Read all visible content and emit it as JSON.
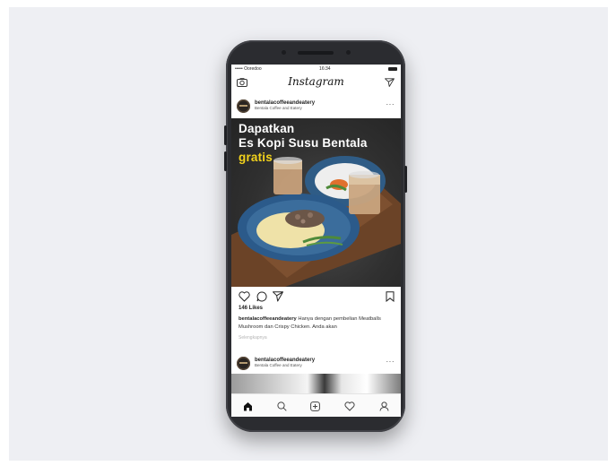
{
  "status_bar": {
    "carrier": "••••• Ooredoo",
    "time": "16:34"
  },
  "app_bar": {
    "title": "Instagram"
  },
  "post": {
    "username": "bentalacoffeeandeatery",
    "location": "Bentala Coffee and Eatery",
    "image_text": {
      "line1": "Dapatkan",
      "line2": "Es Kopi Susu Bentala",
      "line3": "gratis"
    },
    "likes": "146 Likes",
    "caption_user": "bentalacoffeeandeatery",
    "caption_text": "Hanya dengan pembelian Meatballs Mushroom dan Crispy Chicken. Anda akan",
    "see_more": "Selengkapnya"
  },
  "next_post": {
    "username": "bentalacoffeeandeatery",
    "location": "Bentala Coffee and Eatery"
  },
  "colors": {
    "highlight": "#f2d21c",
    "phone_body": "#2b2c30",
    "backdrop": "#eeeff3"
  },
  "icons": {
    "top_left": "camera-icon",
    "top_right": "send-icon",
    "actions": [
      "heart-icon",
      "comment-icon",
      "share-icon",
      "bookmark-icon"
    ],
    "tabs": [
      "home-icon",
      "search-icon",
      "add-post-icon",
      "activity-icon",
      "profile-icon"
    ]
  }
}
